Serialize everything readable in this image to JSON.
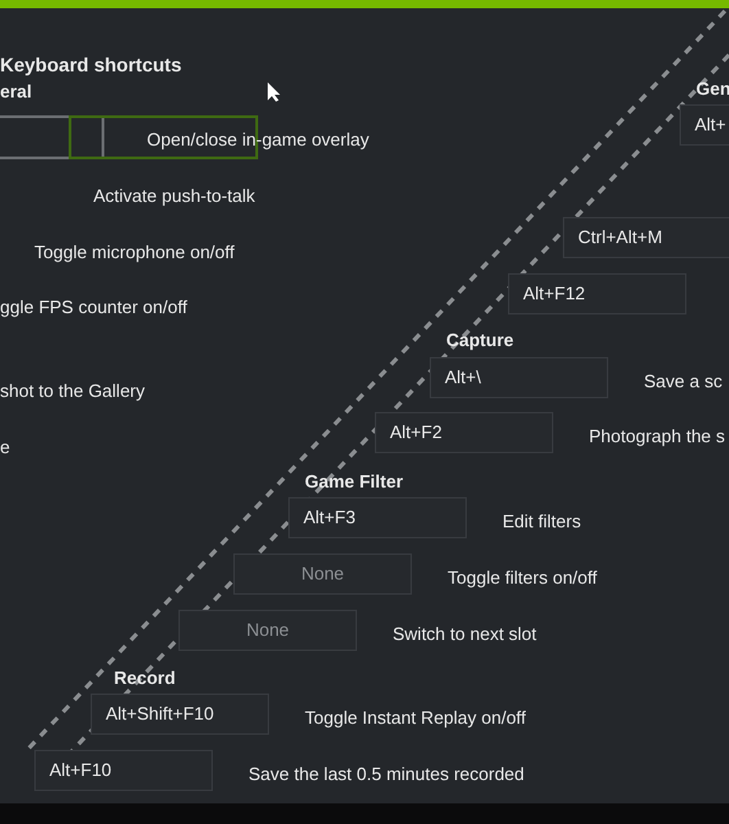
{
  "left_panel": {
    "title": "Keyboard shortcuts",
    "section": "eral",
    "rows": [
      {
        "label": "Open/close in-game overlay",
        "focused": true
      },
      {
        "label": "Activate push-to-talk",
        "focused": false
      },
      {
        "label": "Toggle microphone on/off",
        "focused": false
      },
      {
        "label": "ggle FPS counter on/off",
        "focused": false
      },
      {
        "label": "shot to the Gallery",
        "focused": false
      },
      {
        "label": "e",
        "focused": false
      }
    ]
  },
  "right_panel": {
    "items": [
      {
        "kind": "heading",
        "text": "Gen"
      },
      {
        "kind": "shortcut",
        "shortcut": "Alt+"
      },
      {
        "kind": "shortcut",
        "shortcut": "Ctrl+Alt+M"
      },
      {
        "kind": "shortcut",
        "shortcut": "Alt+F12"
      },
      {
        "kind": "heading",
        "text": "Capture"
      },
      {
        "kind": "shortcut",
        "shortcut": "Alt+\\",
        "action": "Save a sc"
      },
      {
        "kind": "shortcut",
        "shortcut": "Alt+F2",
        "action": "Photograph the s"
      },
      {
        "kind": "heading",
        "text": "Game Filter"
      },
      {
        "kind": "shortcut",
        "shortcut": "Alt+F3",
        "action": "Edit filters"
      },
      {
        "kind": "shortcut",
        "placeholder": "None",
        "action": "Toggle filters on/off"
      },
      {
        "kind": "shortcut",
        "placeholder": "None",
        "action": "Switch to next slot"
      },
      {
        "kind": "heading",
        "text": "Record"
      },
      {
        "kind": "shortcut",
        "shortcut": "Alt+Shift+F10",
        "action": "Toggle Instant Replay on/off"
      },
      {
        "kind": "shortcut",
        "shortcut": "Alt+F10",
        "action": "Save the last 0.5 minutes recorded"
      }
    ]
  }
}
